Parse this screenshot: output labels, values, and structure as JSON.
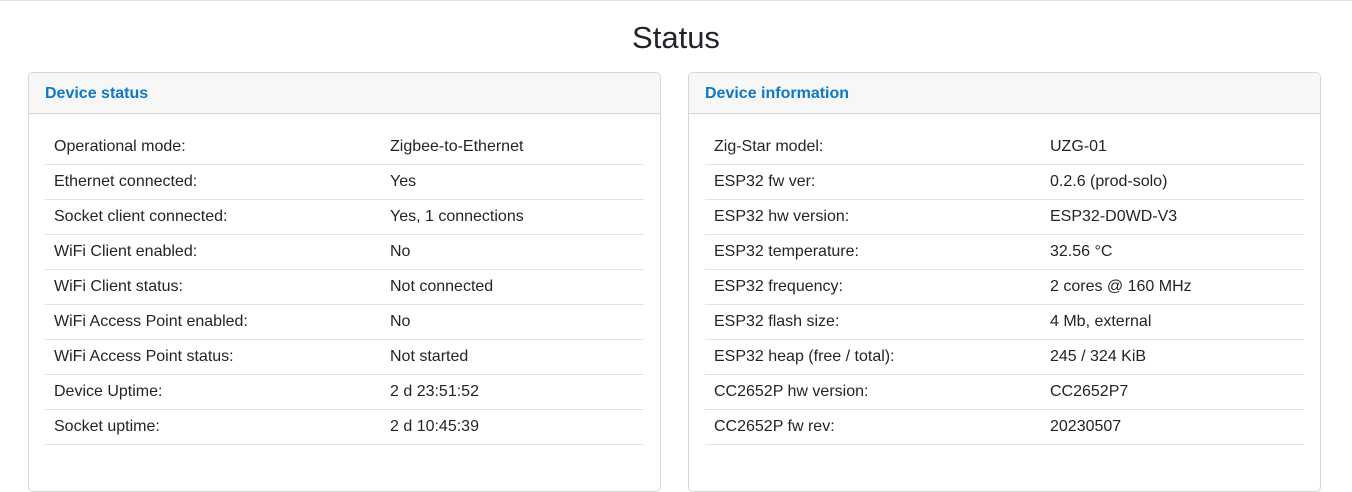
{
  "page_title": "Status",
  "device_status": {
    "title": "Device status",
    "rows": [
      {
        "label": "Operational mode:",
        "value": "Zigbee-to-Ethernet"
      },
      {
        "label": "Ethernet connected:",
        "value": "Yes"
      },
      {
        "label": "Socket client connected:",
        "value": "Yes, 1 connections"
      },
      {
        "label": "WiFi Client enabled:",
        "value": "No"
      },
      {
        "label": "WiFi Client status:",
        "value": "Not connected"
      },
      {
        "label": "WiFi Access Point enabled:",
        "value": "No"
      },
      {
        "label": "WiFi Access Point status:",
        "value": "Not started"
      },
      {
        "label": "Device Uptime:",
        "value": "2 d 23:51:52"
      },
      {
        "label": "Socket uptime:",
        "value": "2 d 10:45:39"
      }
    ]
  },
  "device_information": {
    "title": "Device information",
    "rows": [
      {
        "label": "Zig-Star model:",
        "value": "UZG-01"
      },
      {
        "label": "ESP32 fw ver:",
        "value": "0.2.6 (prod-solo)"
      },
      {
        "label": "ESP32 hw version:",
        "value": "ESP32-D0WD-V3"
      },
      {
        "label": "ESP32 temperature:",
        "value": "32.56 °C"
      },
      {
        "label": "ESP32 frequency:",
        "value": "2 cores @ 160 MHz"
      },
      {
        "label": "ESP32 flash size:",
        "value": "4 Mb, external"
      },
      {
        "label": "ESP32 heap (free / total):",
        "value": "245 / 324 KiB"
      },
      {
        "label": "CC2652P hw version:",
        "value": "CC2652P7"
      },
      {
        "label": "CC2652P fw rev:",
        "value": "20230507"
      }
    ]
  }
}
